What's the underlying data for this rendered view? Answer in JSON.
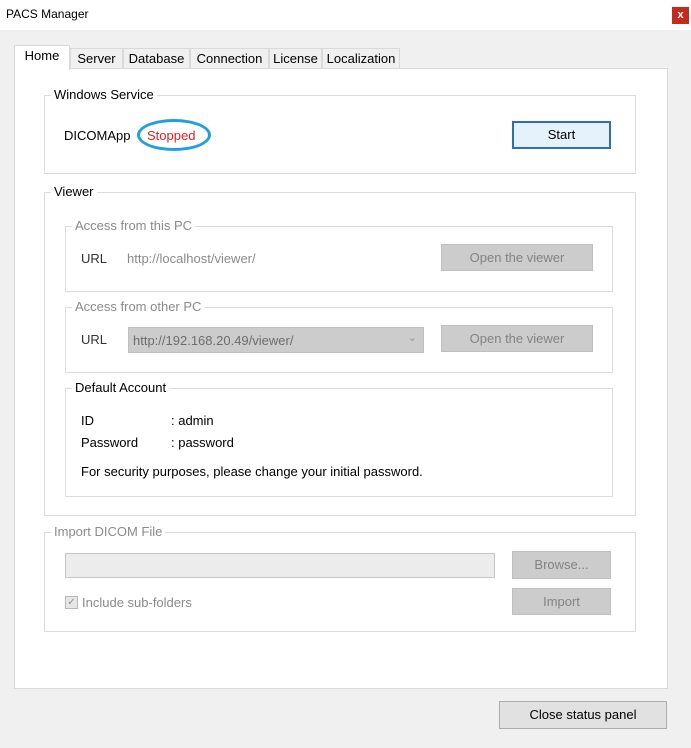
{
  "window": {
    "title": "PACS Manager",
    "close_glyph": "x"
  },
  "tabs": [
    {
      "label": "Home",
      "active": true
    },
    {
      "label": "Server"
    },
    {
      "label": "Database"
    },
    {
      "label": "Connection"
    },
    {
      "label": "License"
    },
    {
      "label": "Localization"
    }
  ],
  "windows_service": {
    "legend": "Windows Service",
    "service_name": "DICOMApp",
    "status": "Stopped",
    "status_color": "#e02020",
    "start_label": "Start"
  },
  "viewer": {
    "legend": "Viewer",
    "this_pc": {
      "legend": "Access from this PC",
      "url_label": "URL",
      "url_value": "http://localhost/viewer/",
      "open_label": "Open the viewer"
    },
    "other_pc": {
      "legend": "Access from other PC",
      "url_label": "URL",
      "url_value": "http://192.168.20.49/viewer/",
      "open_label": "Open the viewer"
    },
    "default_account": {
      "legend": "Default Account",
      "id_label": "ID",
      "id_value": ": admin",
      "password_label": "Password",
      "password_value": ": password",
      "note": "For security purposes, please change your initial password."
    }
  },
  "import": {
    "legend": "Import DICOM File",
    "path_value": "",
    "browse_label": "Browse...",
    "subfolders_label": "Include sub-folders",
    "subfolders_checked": true,
    "import_label": "Import"
  },
  "footer": {
    "close_panel_label": "Close status panel"
  },
  "icons": {
    "check": "check-icon",
    "dropdown": "chevron-down-icon",
    "close": "close-icon"
  }
}
